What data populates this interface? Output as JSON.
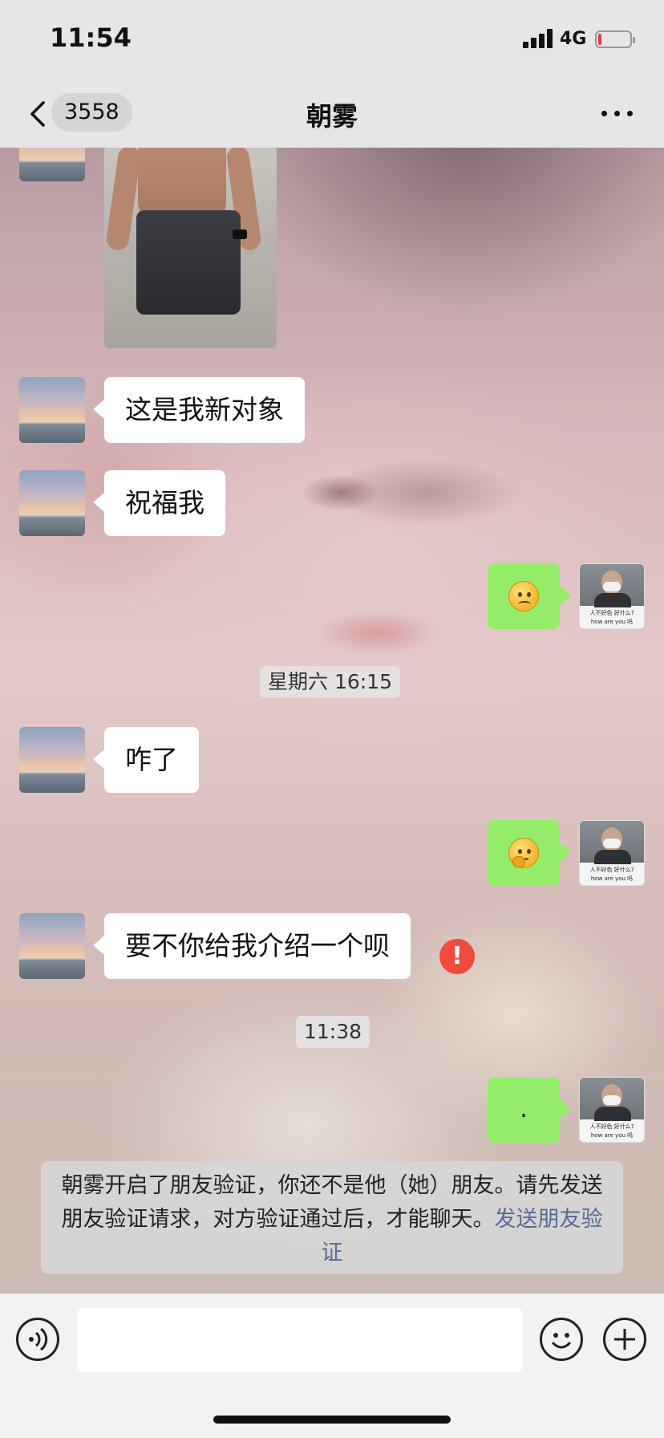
{
  "status_bar": {
    "time": "11:54",
    "network": "4G",
    "battery_level": 0.1,
    "battery_color": "#e23a3a"
  },
  "nav": {
    "unread_count": "3558",
    "title": "朝雾",
    "back_icon": "chevron-left-icon",
    "more_icon": "more-dots-icon"
  },
  "messages": [
    {
      "side": "in",
      "type": "image",
      "icon": "photo-message"
    },
    {
      "side": "in",
      "type": "text",
      "text": "这是我新对象"
    },
    {
      "side": "in",
      "type": "text",
      "text": "祝福我"
    },
    {
      "side": "out",
      "type": "emoji",
      "emoji": "slightly-frowning-face"
    },
    {
      "side": "time",
      "text": "星期六 16:15"
    },
    {
      "side": "in",
      "type": "text",
      "text": "咋了"
    },
    {
      "side": "out",
      "type": "emoji",
      "emoji": "thinking-face"
    },
    {
      "side": "in",
      "type": "text",
      "text": "要不你给我介绍一个呗"
    },
    {
      "side": "time",
      "text": "11:38"
    },
    {
      "side": "out",
      "type": "text",
      "text": ".",
      "status": "failed"
    }
  ],
  "self_avatar": {
    "caption_line1": "人不好色 好什么?",
    "caption_line2": "how are you 吗"
  },
  "system_notice": {
    "text": "朝雾开启了朋友验证，你还不是他（她）朋友。请先发送朋友验证请求，对方验证通过后，才能聊天。",
    "link": "发送朋友验证"
  },
  "input_bar": {
    "value": "",
    "voice_icon": "voice-icon",
    "emoji_icon": "smiley-icon",
    "plus_icon": "plus-icon"
  },
  "colors": {
    "outgoing_bubble": "#95ec69",
    "incoming_bubble": "#ffffff",
    "link": "#576b95",
    "error": "#f04b3e"
  }
}
